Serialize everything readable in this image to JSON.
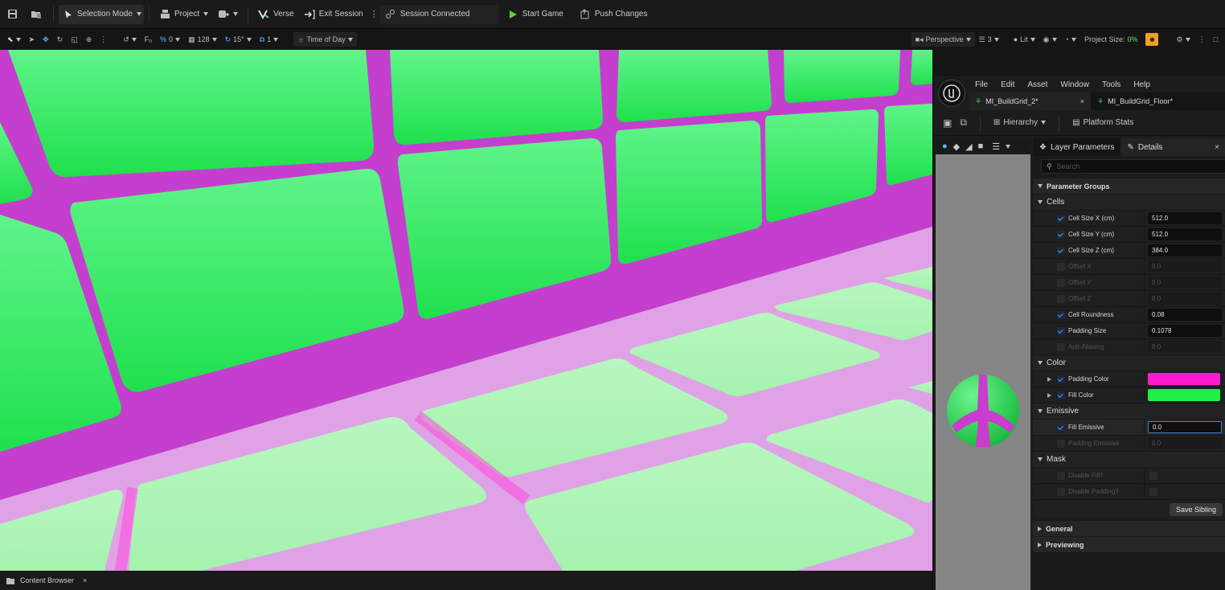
{
  "topbar": {
    "selection_mode": "Selection Mode",
    "project": "Project",
    "verse": "Verse",
    "exit_session": "Exit Session",
    "session_status": "Session Connected",
    "start_game": "Start Game",
    "push_changes": "Push Changes"
  },
  "viewport_toolbar": {
    "grid_snap": "0",
    "location_snap": "128",
    "rotation_snap": "15°",
    "scale_snap": "1",
    "time_of_day": "Time of Day",
    "perspective": "Perspective",
    "camera_speed": "3",
    "lit": "Lit",
    "project_size_label": "Project Size:",
    "project_size_value": "0%"
  },
  "bottombar": {
    "content_browser": "Content Browser"
  },
  "editor": {
    "menu": [
      "File",
      "Edit",
      "Asset",
      "Window",
      "Tools",
      "Help"
    ],
    "tabs": [
      "MI_BuildGrid_2*",
      "MI_BuildGrid_Floor*"
    ],
    "hierarchy": "Hierarchy",
    "platform_stats": "Platform Stats",
    "details_tabs": {
      "layer_params": "Layer Parameters",
      "details": "Details"
    },
    "search_placeholder": "Search",
    "groups": {
      "parameter_groups": "Parameter Groups",
      "cells": "Cells",
      "color": "Color",
      "emissive": "Emissive",
      "mask": "Mask",
      "general": "General",
      "previewing": "Previewing"
    },
    "cells": [
      {
        "label": "Cell Size X (cm)",
        "value": "512.0",
        "checked": true
      },
      {
        "label": "Cell Size Y (cm)",
        "value": "512.0",
        "checked": true
      },
      {
        "label": "Cell Size Z (cm)",
        "value": "384.0",
        "checked": true
      },
      {
        "label": "Offset X",
        "value": "0.0",
        "checked": false
      },
      {
        "label": "Offset Y",
        "value": "0.0",
        "checked": false
      },
      {
        "label": "Offset Z",
        "value": "0.0",
        "checked": false
      },
      {
        "label": "Cell Roundness",
        "value": "0.08",
        "checked": true
      },
      {
        "label": "Padding Size",
        "value": "0.1078",
        "checked": true
      },
      {
        "label": "Anti-Aliasing",
        "value": "0.0",
        "checked": false
      }
    ],
    "color_rows": [
      {
        "label": "Padding Color",
        "color": "#ff1ad1",
        "checked": true
      },
      {
        "label": "Fill Color",
        "color": "#1ef046",
        "checked": true
      }
    ],
    "emissive_rows": [
      {
        "label": "Fill Emissive",
        "value": "0.0",
        "checked": true
      },
      {
        "label": "Padding Emissive",
        "value": "0.0",
        "checked": false
      }
    ],
    "mask_rows": [
      {
        "label": "Disable Fill?"
      },
      {
        "label": "Disable Padding?"
      }
    ],
    "save_sibling": "Save Sibling"
  },
  "colors": {
    "grid_fill": "#22e655",
    "grid_padding": "#d93fd6",
    "accent": "#f0a020"
  }
}
